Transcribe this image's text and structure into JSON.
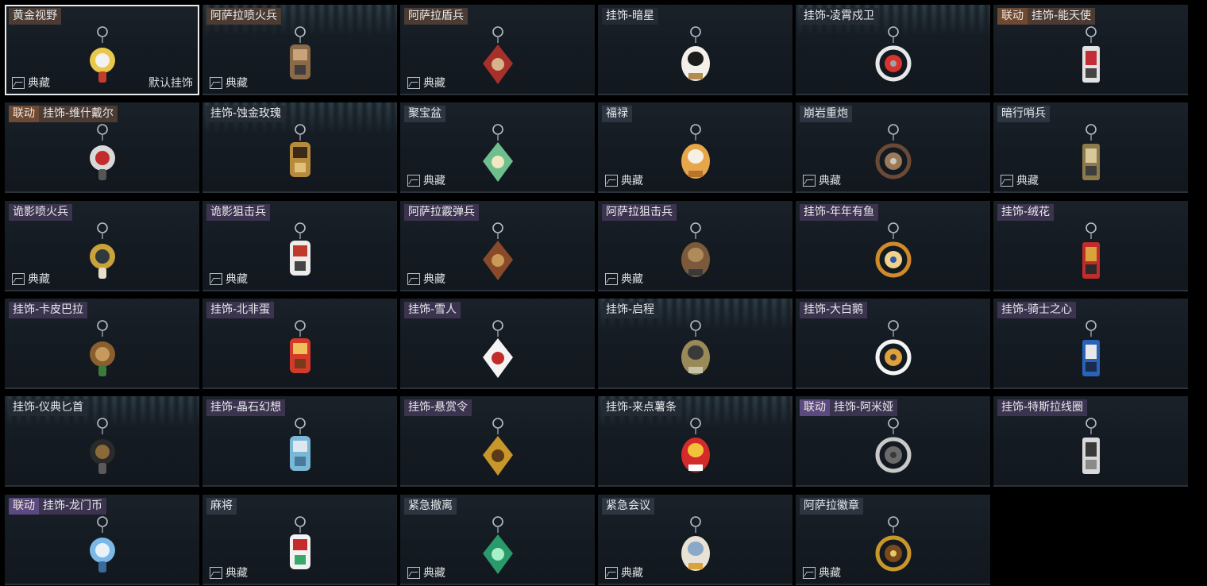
{
  "labels": {
    "collection": "典藏",
    "default": "默认挂饰"
  },
  "tiles": [
    {
      "title": "黄金视野",
      "selected": true,
      "default": true,
      "collection": true,
      "streak": false,
      "icon": "sunflower-charm-icon"
    },
    {
      "title": "阿萨拉喷火兵",
      "collection": true,
      "streak": true,
      "icon": "flamethrower-soldier-charm-icon"
    },
    {
      "title": "阿萨拉盾兵",
      "collection": true,
      "icon": "shield-soldier-charm-icon"
    },
    {
      "title": "挂饰-暗星",
      "icon": "dark-star-charm-icon"
    },
    {
      "title": "挂饰-凌霄戍卫",
      "streak": true,
      "icon": "rocket-charm-icon"
    },
    {
      "tag": "联动",
      "title": "挂饰-能天使",
      "icon": "exusiai-charm-icon"
    },
    {
      "tag": "联动",
      "title": "挂饰-维什戴尔",
      "icon": "wisadel-charm-icon"
    },
    {
      "title": "挂饰-蚀金玫瑰",
      "streak": true,
      "icon": "gold-rose-charm-icon"
    },
    {
      "title": "聚宝盆",
      "collection": true,
      "icon": "treasure-bowl-charm-icon"
    },
    {
      "title": "福禄",
      "collection": true,
      "icon": "gourd-charm-icon"
    },
    {
      "title": "崩岩重炮",
      "collection": true,
      "icon": "heavy-gunner-charm-icon"
    },
    {
      "title": "暗行哨兵",
      "collection": true,
      "icon": "scout-charm-icon"
    },
    {
      "title": "诡影喷火兵",
      "collection": true,
      "icon": "shadow-flamer-charm-icon"
    },
    {
      "title": "诡影狙击兵",
      "collection": true,
      "icon": "shadow-sniper-charm-icon"
    },
    {
      "title": "阿萨拉霰弹兵",
      "collection": true,
      "icon": "shotgunner-charm-icon"
    },
    {
      "title": "阿萨拉狙击兵",
      "collection": true,
      "icon": "sniper-charm-icon"
    },
    {
      "title": "挂饰-年年有鱼",
      "icon": "fish-charm-icon"
    },
    {
      "title": "挂饰-绒花",
      "icon": "velvet-flower-charm-icon"
    },
    {
      "title": "挂饰-卡皮巴拉",
      "icon": "capybara-charm-icon"
    },
    {
      "title": "挂饰-北非蛋",
      "icon": "shakshuka-charm-icon"
    },
    {
      "title": "挂饰-雪人",
      "icon": "snowman-charm-icon"
    },
    {
      "title": "挂饰-启程",
      "streak": true,
      "icon": "departure-badge-charm-icon"
    },
    {
      "title": "挂饰-大白鹅",
      "icon": "goose-charm-icon"
    },
    {
      "title": "挂饰-骑士之心",
      "icon": "knight-heart-charm-icon"
    },
    {
      "title": "挂饰-仪典匕首",
      "streak": true,
      "icon": "ceremonial-dagger-charm-icon"
    },
    {
      "title": "挂饰-晶石幻想",
      "icon": "crystal-fantasy-charm-icon"
    },
    {
      "title": "挂饰-悬赏令",
      "icon": "bounty-scroll-charm-icon"
    },
    {
      "title": "挂饰-来点薯条",
      "streak": true,
      "icon": "fries-charm-icon"
    },
    {
      "tag": "联动",
      "title": "挂饰-阿米娅",
      "icon": "amiya-charm-icon"
    },
    {
      "title": "挂饰-特斯拉线圈",
      "icon": "tesla-coil-charm-icon"
    },
    {
      "tag": "联动",
      "title": "挂饰-龙门币",
      "icon": "lungmen-coin-charm-icon"
    },
    {
      "title": "麻将",
      "collection": true,
      "icon": "mahjong-charm-icon"
    },
    {
      "title": "紧急撤离",
      "collection": true,
      "icon": "emergency-evac-charm-icon"
    },
    {
      "title": "紧急会议",
      "collection": true,
      "icon": "emergency-meeting-charm-icon"
    },
    {
      "title": "阿萨拉徽章",
      "collection": true,
      "icon": "asala-emblem-charm-icon"
    }
  ],
  "colors": {
    "panel": "#141a21",
    "brown_tag": "#6f4a33",
    "purple_tag": "#5b4a80",
    "selected_outline": "#e8ecef"
  }
}
